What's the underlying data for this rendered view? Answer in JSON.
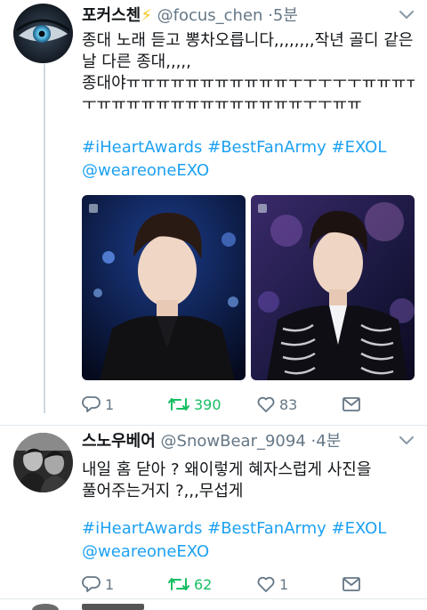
{
  "tweets": [
    {
      "display_name": "포커스첸",
      "name_emoji": "⚡",
      "handle": "@focus_chen",
      "separator": "·",
      "time": "5분",
      "text_lines": [
        "종대 노래 듣고 뽕차오릅니다,,,,,,,,작년 골디 같은",
        "날 다른 종대,,,,,",
        "종대야ㅠㅠㅠㅠㅠㅠㅠㅠㅠㅠㅠㅜㅜㅜㅜㅜㅠㅠㅠㅠ",
        "ㅜㅠㅠㅠㅠㅠㅠㅠㅠㅠㅠㅠㅠㅠㅠㅜㅜㅠㅠ"
      ],
      "hashtag_lines": [
        "#iHeartAwards #BestFanArmy #EXOL",
        "@weareoneEXO"
      ],
      "media_count": 2,
      "replies": "1",
      "retweets": "390",
      "likes": "83"
    },
    {
      "display_name": "스노우베어",
      "handle": "@SnowBear_9094",
      "separator": "·",
      "time": "4분",
      "text_lines": [
        "내일 홈 닫아 ? 왜이렇게 혜자스럽게 사진을",
        "풀어주는거지 ?,,,무섭게"
      ],
      "hashtag_lines": [
        "#iHeartAwards #BestFanArmy #EXOL",
        "@weareoneEXO"
      ],
      "replies": "1",
      "retweets": "62",
      "likes": "1"
    }
  ],
  "colors": {
    "accent": "#1da1f2",
    "retweet": "#17bf63",
    "muted": "#657786"
  },
  "icons": [
    "reply-icon",
    "retweet-icon",
    "like-icon",
    "direct-message-icon",
    "chevron-down-icon"
  ]
}
